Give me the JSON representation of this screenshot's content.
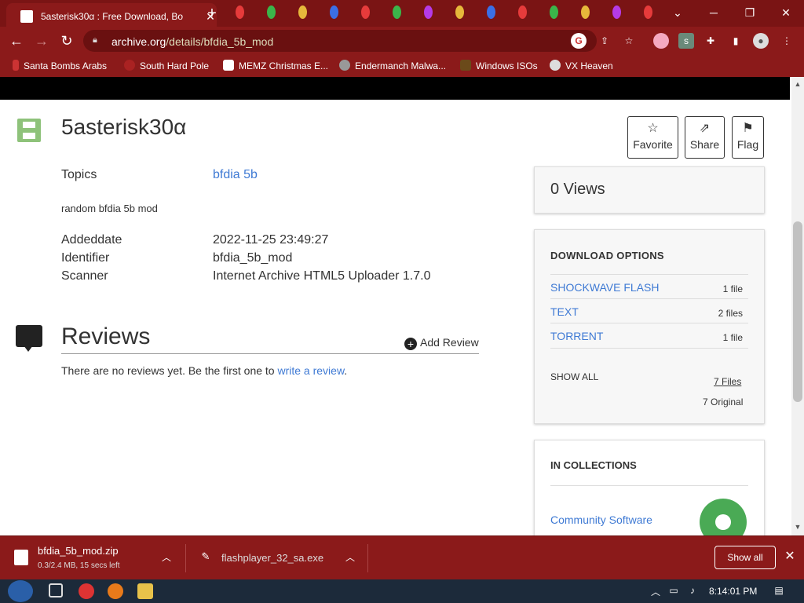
{
  "browser": {
    "tab_title": "5asterisk30α : Free Download, Bo",
    "url_host": "archive.org",
    "url_path": "/details/bfdia_5b_mod",
    "bookmarks": [
      "Santa Bombs Arabs",
      "South Hard Pole",
      "MEMZ Christmas E...",
      "Endermanch Malwa...",
      "Windows ISOs",
      "VX Heaven"
    ]
  },
  "item": {
    "title": "5asterisk30α",
    "actions": {
      "favorite": "Favorite",
      "share": "Share",
      "flag": "Flag"
    },
    "topics_label": "Topics",
    "topics_value": "bfdia 5b",
    "description": "random bfdia 5b mod",
    "meta": [
      {
        "label": "Addeddate",
        "value": "2022-11-25 23:49:27"
      },
      {
        "label": "Identifier",
        "value": "bfdia_5b_mod"
      },
      {
        "label": "Scanner",
        "value": "Internet Archive HTML5 Uploader 1.7.0"
      }
    ]
  },
  "reviews": {
    "heading": "Reviews",
    "add_label": "Add Review",
    "empty_prefix": "There are no reviews yet. Be the first one to ",
    "empty_link": "write a review",
    "empty_suffix": "."
  },
  "sidebar": {
    "views": "0 Views",
    "download_title": "DOWNLOAD OPTIONS",
    "download_rows": [
      {
        "name": "SHOCKWAVE FLASH",
        "count": "1 file"
      },
      {
        "name": "TEXT",
        "count": "2 files"
      },
      {
        "name": "TORRENT",
        "count": "1 file"
      }
    ],
    "show_all": "SHOW ALL",
    "files_link": "7 Files",
    "original": "7 Original",
    "collections_title": "IN COLLECTIONS",
    "collection_item": "Community Software"
  },
  "downloads": {
    "item1_name": "bfdia_5b_mod.zip",
    "item1_status": "0.3/2.4 MB, 15 secs left",
    "item2_name": "flashplayer_32_sa.exe",
    "show_all": "Show all"
  },
  "taskbar": {
    "clock": "8:14:01 PM"
  },
  "colors": {
    "chrome": "#8b1a1a",
    "link": "#3f7ad4",
    "collection_logo": "#4aaa55",
    "item_icon": "#8ec27a"
  }
}
